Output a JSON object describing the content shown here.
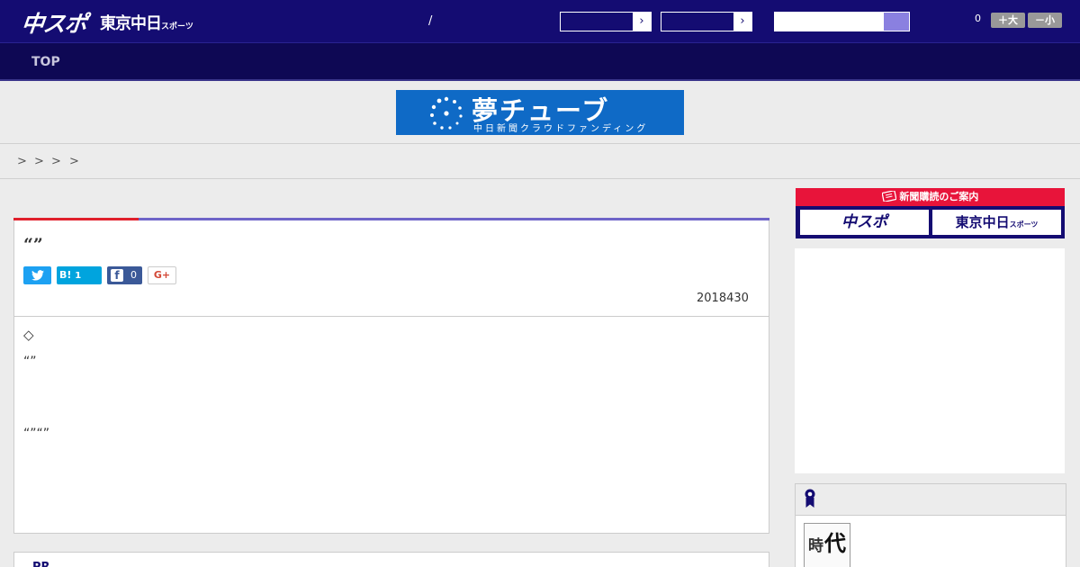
{
  "header": {
    "logo_chuspo": "中スポ",
    "logo_tokyo_main": "東京中日",
    "logo_tokyo_suffix": "スポーツ",
    "slash": "/",
    "select_arrow_1": "›",
    "select_arrow_2": "›",
    "font_size_count": "0",
    "font_bigger": "＋大",
    "font_smaller": "－小"
  },
  "nav": {
    "top_label": "TOP"
  },
  "banner": {
    "title": "夢チューブ",
    "subtitle": "中日新聞クラウドファンディング"
  },
  "breadcrumb": {
    "separators": [
      ">",
      ">",
      ">",
      ">"
    ]
  },
  "article": {
    "title": "“”",
    "share_twitter_icon": "twitter-icon",
    "share_hatena_label": "B!",
    "share_hatena_count": "1",
    "share_facebook_icon_glyph": "f",
    "share_facebook_count": "0",
    "share_gplus_label": "G+",
    "date": "2018430",
    "body_marker": "◇",
    "body_quote_1": "“”",
    "body_quote_2": "“”“”"
  },
  "related": {
    "label": "PR"
  },
  "sidebar": {
    "subscription_heading": "新聞購読のご案内",
    "subscription_chuspo": "中スポ",
    "subscription_tokyo_main": "東京中日",
    "subscription_tokyo_suffix": "スポーツ",
    "ranking_thumb_char_1": "時",
    "ranking_thumb_char_2": "代"
  },
  "colors": {
    "header_bg": "#140c72",
    "nav_bg": "#0e0854",
    "accent_red": "#e0202c",
    "accent_purple": "#6e64c8",
    "banner_blue": "#0f6ac6"
  }
}
